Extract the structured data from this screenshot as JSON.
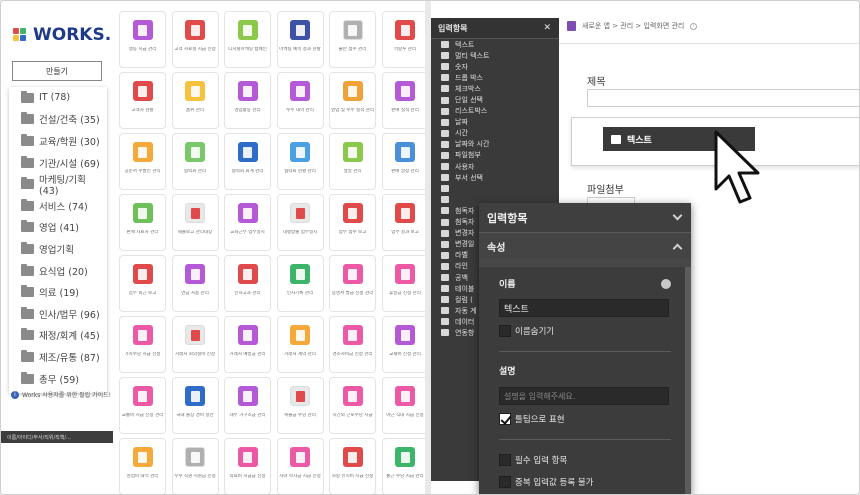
{
  "brand": {
    "name": "WORKS.",
    "colors": {
      "dark": "#1e3a8a"
    }
  },
  "sidebar": {
    "create_label": "만들기",
    "categories": [
      "IT (78)",
      "건설/건축 (35)",
      "교육/학원 (30)",
      "기관/시설 (69)",
      "마케팅/기획 (43)",
      "서비스 (74)",
      "영업 (41)",
      "영업기획",
      "요식업 (20)",
      "의료 (19)",
      "인사/법무 (96)",
      "재정/회계 (45)",
      "제조/유통 (87)",
      "총무 (59)"
    ],
    "guide_text": "Works 사용자를 위한 필립 가이드!",
    "bottom_text": "이름/아이디/부서/직위/직책/..."
  },
  "apps": [
    {
      "label": "행동 지급 관리",
      "color": "#b45ad6"
    },
    {
      "label": "고객 자료실 지급 신청",
      "color": "#e04a4a"
    },
    {
      "label": "디지털마케팅 캠페인",
      "color": "#8cc84b"
    },
    {
      "label": "마케팅 예측 결과 현황",
      "color": "#3d52a6"
    },
    {
      "label": "불만 접수 관리",
      "color": "#b0b0b0"
    },
    {
      "label": "역량투 관리",
      "color": "#e04a4a"
    },
    {
      "label": "고객사 현황",
      "color": "#e04a4a"
    },
    {
      "label": "품위 관리",
      "color": "#f6c23e"
    },
    {
      "label": "영업활동 관리",
      "color": "#b45ad6"
    },
    {
      "label": "수주 내역 관리",
      "color": "#b45ad6"
    },
    {
      "label": "영업 및 수주 실적 관리",
      "color": "#f0a23a"
    },
    {
      "label": "판매 실적 관리",
      "color": "#b45ad6"
    },
    {
      "label": "공문서 수발신 관리",
      "color": "#f6a93b"
    },
    {
      "label": "협력회 관리",
      "color": "#7bc86c"
    },
    {
      "label": "협력회 회계 관리",
      "color": "#2f6cc8"
    },
    {
      "label": "협력회 현황 관리",
      "color": "#4aa0e0"
    },
    {
      "label": "생일 관리",
      "color": "#8cc84b"
    },
    {
      "label": "판매 일정 관리",
      "color": "#4a90d9"
    },
    {
      "label": "판매 자료사 관리",
      "color": "#6fbf5b"
    },
    {
      "label": "제출보고 관리대장",
      "color": "#e8e8e8"
    },
    {
      "label": "교육근무 업무일지",
      "color": "#b45ad6"
    },
    {
      "label": "대행방출 업무일지",
      "color": "#e8e8e8"
    },
    {
      "label": "업무 접수 보고",
      "color": "#e04a4a"
    },
    {
      "label": "업무 결과 보고",
      "color": "#e04a4a"
    },
    {
      "label": "업무 외근 보고",
      "color": "#e04a4a"
    },
    {
      "label": "연금 사용 관리",
      "color": "#b45ad6"
    },
    {
      "label": "인사고과 관리",
      "color": "#e04a4a"
    },
    {
      "label": "인사기록 관리",
      "color": "#3cb56a"
    },
    {
      "label": "증명서 발급 신청 관리",
      "color": "#ec5aa6"
    },
    {
      "label": "휴일금 신청 관리",
      "color": "#ec5aa6"
    },
    {
      "label": "가족수당 지급 신청",
      "color": "#ec5aa6"
    },
    {
      "label": "거래처 회의실비 신청",
      "color": "#e8e8e8"
    },
    {
      "label": "거래처 예방금 관리",
      "color": "#b45ad6"
    },
    {
      "label": "거래처 계약 관리",
      "color": "#f6a93b"
    },
    {
      "label": "경조사비금 신청 관리",
      "color": "#ec5aa6"
    },
    {
      "label": "교재비 신청 관리",
      "color": "#b45ad6"
    },
    {
      "label": "교통비 지급 신청 관리",
      "color": "#ec5aa6"
    },
    {
      "label": "국내 출장 경비 정산",
      "color": "#2f6cc8"
    },
    {
      "label": "대부 가구소금 관리",
      "color": "#b45ad6"
    },
    {
      "label": "복불금 수당 관리",
      "color": "#e8e8e8"
    },
    {
      "label": "시간외 근로수당 지급",
      "color": "#ec5aa6"
    },
    {
      "label": "야근 식대 지급 신청",
      "color": "#ec5aa6"
    },
    {
      "label": "영업비 내역 관리",
      "color": "#f6a93b"
    },
    {
      "label": "우수 직원 지원금 신청",
      "color": "#b0b0b0"
    },
    {
      "label": "의료비 지급금 신청",
      "color": "#ec5aa6"
    },
    {
      "label": "자녀 학자금 지급 신청",
      "color": "#ec5aa6"
    },
    {
      "label": "차량 유지비 지급 신청",
      "color": "#e04a4a"
    },
    {
      "label": "통근 수당 지급 관리",
      "color": "#3cb56a"
    }
  ],
  "builder": {
    "breadcrumb": "새로운 앱 > 관리 > 입력화면 관리",
    "palette_title": "입력항목",
    "palette_items": [
      "텍스트",
      "멀티 텍스트",
      "숫자",
      "드롭 박스",
      "체크박스",
      "단일 선택",
      "리스트박스",
      "날짜",
      "시간",
      "날짜와 시간",
      "파일첨부",
      "사용자",
      "부서 선택",
      "",
      "",
      "첨독자",
      "첨독자",
      "변경자",
      "변경일",
      "라벨",
      "라인",
      "공백",
      "테이블",
      "컬럼 (",
      "자동 계",
      "데이터",
      "연동항"
    ],
    "field_title_label": "제목",
    "dragged_item_label": "텍스트",
    "field_file_label": "파일첨부"
  },
  "properties": {
    "header": "입력항목",
    "section": "속성",
    "name_label": "이름",
    "name_value": "텍스트",
    "hide_name_label": "이름숨기기",
    "desc_label": "설명",
    "desc_placeholder": "설명을 입력해주세요.",
    "tooltip_label": "툴팁으로 표현",
    "tooltip_checked": true,
    "required_label": "필수 입력 항목",
    "no_dup_label": "중복 입력값 등록 불가"
  }
}
